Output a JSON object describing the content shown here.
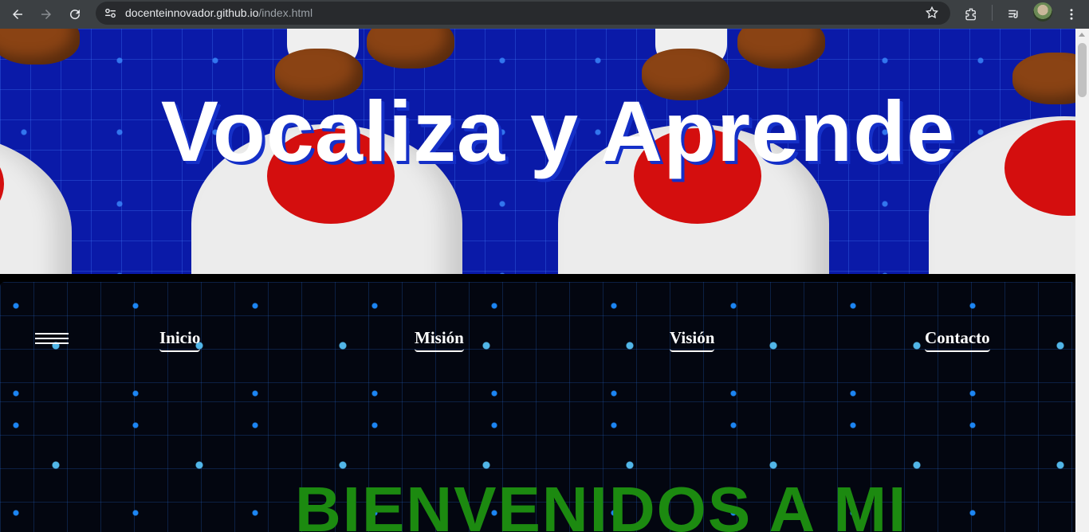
{
  "browser": {
    "url_domain": "docenteinnovador.github.io",
    "url_path": "/index.html",
    "icons": [
      "back-icon",
      "forward-icon",
      "reload-icon",
      "site-settings-icon",
      "star-icon",
      "extensions-icon",
      "reading-list-icon",
      "avatar",
      "more-icon"
    ]
  },
  "header": {
    "title": "Vocaliza y Aprende"
  },
  "nav": {
    "items": [
      {
        "label": "Inicio"
      },
      {
        "label": "Misión"
      },
      {
        "label": "Visión"
      },
      {
        "label": "Contacto"
      }
    ]
  },
  "main": {
    "welcome": "BIENVENIDOS A MI"
  },
  "colors": {
    "header_bg": "#0a1aa8",
    "welcome_text": "#1c8a10",
    "nav_text": "#ffffff"
  }
}
